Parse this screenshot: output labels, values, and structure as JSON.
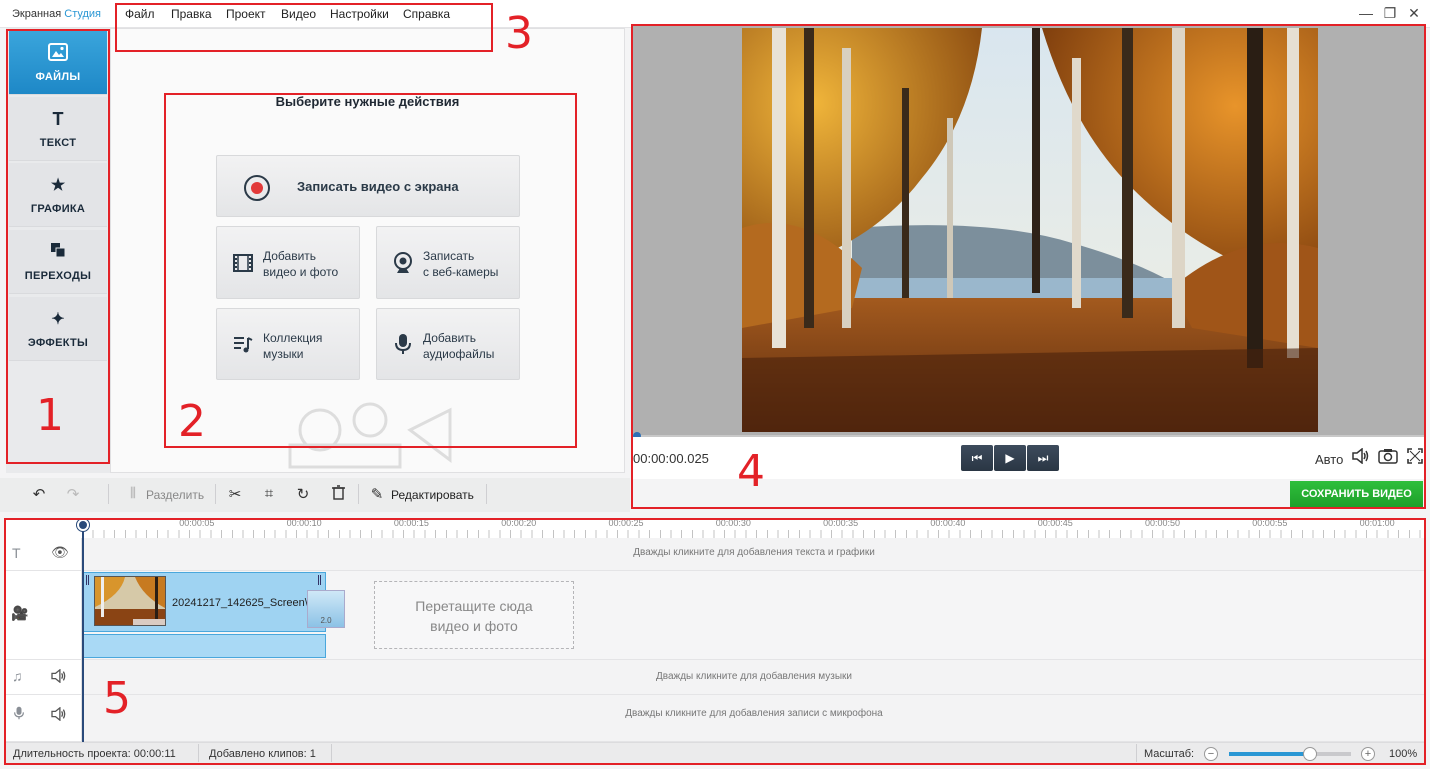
{
  "app": {
    "title_part1": "Экранная",
    "title_part2": "Студия"
  },
  "menu": [
    "Файл",
    "Правка",
    "Проект",
    "Видео",
    "Настройки",
    "Справка"
  ],
  "window_controls": {
    "minimize": "—",
    "maximize": "❐",
    "close": "✕"
  },
  "side_tabs": [
    {
      "label": "ФАЙЛЫ",
      "icon": "image-icon",
      "active": true
    },
    {
      "label": "ТЕКСТ",
      "icon": "text-icon",
      "active": false
    },
    {
      "label": "ГРАФИКА",
      "icon": "star-icon",
      "active": false
    },
    {
      "label": "ПЕРЕХОДЫ",
      "icon": "transitions-icon",
      "active": false
    },
    {
      "label": "ЭФФЕКТЫ",
      "icon": "magic-wand-icon",
      "active": false
    }
  ],
  "actions": {
    "title": "Выберите нужные действия",
    "record_screen": "Записать видео с экрана",
    "add_media_line1": "Добавить",
    "add_media_line2": "видео и фото",
    "webcam_line1": "Записать",
    "webcam_line2": "с веб-камеры",
    "music_line1": "Коллекция",
    "music_line2": "музыки",
    "audio_line1": "Добавить",
    "audio_line2": "аудиофайлы"
  },
  "player": {
    "timecode": "00:00:00.025",
    "quality": "Авто",
    "save_label": "СОХРАНИТЬ ВИДЕО"
  },
  "toolbar": {
    "split_label": "Разделить",
    "edit_label": "Редактировать"
  },
  "ruler_labels": [
    "00:00:05",
    "00:00:10",
    "00:00:15",
    "00:00:20",
    "00:00:25",
    "00:00:30",
    "00:00:35",
    "00:00:40",
    "00:00:45",
    "00:00:50",
    "00:00:55",
    "00:01:00"
  ],
  "tracks": {
    "text_hint": "Дважды кликните для добавления текста и графики",
    "music_hint": "Дважды кликните для добавления музыки",
    "mic_hint": "Дважды кликните для добавления записи с микрофона",
    "clip_name": "20241217_142625_Screen\\",
    "transition_duration": "2.0",
    "drop_line1": "Перетащите сюда",
    "drop_line2": "видео и фото"
  },
  "status": {
    "duration_label": "Длительность проекта:",
    "duration_value": "00:00:11",
    "clips_label": "Добавлено клипов:",
    "clips_value": "1",
    "zoom_label": "Масштаб:",
    "zoom_value": "100%",
    "zoom_level": 0.66
  },
  "annotations": [
    "1",
    "2",
    "3",
    "4",
    "5"
  ],
  "colors": {
    "accent": "#2a97d4",
    "save": "#1d9e29",
    "annotation": "#e32127"
  }
}
